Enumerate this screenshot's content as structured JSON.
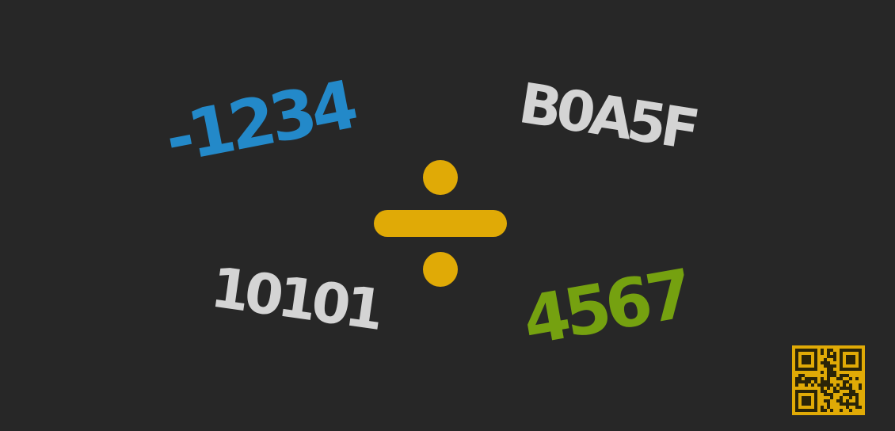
{
  "colors": {
    "background": "#272727",
    "blue": "#2389c9",
    "silver": "#d4d4d4",
    "green": "#75a110",
    "gold": "#e0aa06",
    "qr_dark": "#2a2408"
  },
  "numbers": {
    "negative_decimal": "-1234",
    "hexadecimal": "B0A5F",
    "binary": "10101",
    "decimal": "4567"
  },
  "icons": {
    "division": "division-sign-icon",
    "qr": "qr-code-icon"
  }
}
